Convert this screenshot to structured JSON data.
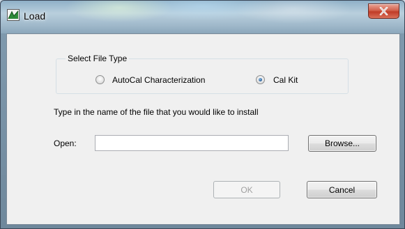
{
  "window": {
    "title": "Load",
    "app_icon": "load-app-icon",
    "close_icon": "close-icon",
    "close_color": "#c7432f"
  },
  "file_type": {
    "group_label": "Select File Type",
    "options": [
      {
        "label": "AutoCal Characterization",
        "selected": false
      },
      {
        "label": "Cal Kit",
        "selected": true
      }
    ]
  },
  "instructions": "Type in the name of the file that you would like to install",
  "open": {
    "label": "Open:",
    "value": ""
  },
  "buttons": {
    "browse": "Browse...",
    "ok": "OK",
    "cancel": "Cancel"
  }
}
